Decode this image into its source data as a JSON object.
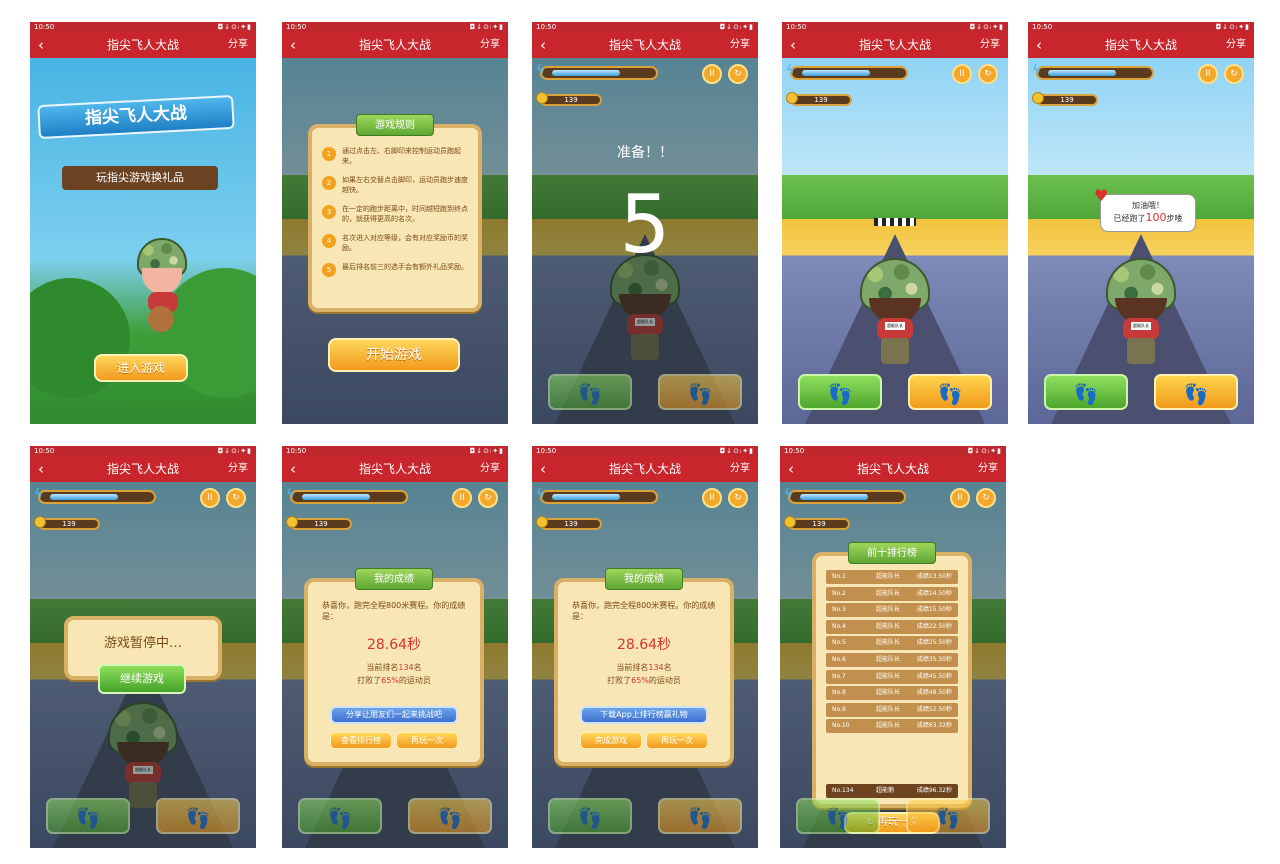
{
  "status": {
    "time": "10:50",
    "icons": "◘↓⊙ᵢ✦▮"
  },
  "app": {
    "title": "指尖飞人大战",
    "share": "分享",
    "back": "‹"
  },
  "welcome": {
    "logo": "指尖飞人大战",
    "subtitle": "玩指尖游戏换礼品",
    "enter_button": "进入游戏"
  },
  "rules": {
    "title": "游戏规则",
    "items": [
      {
        "n": "1",
        "text": "通过点击左、右脚印来控制运动员跑起来。"
      },
      {
        "n": "2",
        "text": "如果左右交替点击脚印，运动员跑步速度越快。"
      },
      {
        "n": "3",
        "text": "在一定的跑步距离中，时间越短跑到终点的，就获得更高的名次。"
      },
      {
        "n": "4",
        "text": "名次进入对应等级，会有对应奖励币的奖励。"
      },
      {
        "n": "5",
        "text": "最后排名前三的选手会有额外礼品奖励。"
      }
    ],
    "start_button": "开始游戏"
  },
  "hud": {
    "coins": "139",
    "pause_icon": "II",
    "restart_icon": "↻",
    "energy_ratio": 0.6
  },
  "countdown": {
    "ready": "准备！！",
    "number": "5"
  },
  "cheer": {
    "line1": "加油哦！",
    "line2_a": "已经跑了",
    "steps": "100",
    "line2_b": "步喽"
  },
  "pause": {
    "text": "游戏暂停中…",
    "continue_button": "继续游戏"
  },
  "result": {
    "title": "我的成绩",
    "intro": "恭喜你，跑完全程800米赛程。你的成绩是：",
    "time": "28.64秒",
    "rank_a": "当前排名",
    "rank_n": "134",
    "rank_b": "名",
    "beat_a": "打败了",
    "beat_n": "65%",
    "beat_b": "的运动员",
    "share_button": "分享让朋友们一起来挑战吧",
    "download_button": "下载App上排行榜赢礼物",
    "leaderboard_button": "查看排行榜",
    "replay_button": "再玩一次",
    "done_button": "完成游戏"
  },
  "leaderboard": {
    "title": "前十排行榜",
    "rows": [
      {
        "rank": "No.1",
        "name": "超能队长",
        "score": "成绩13.50秒"
      },
      {
        "rank": "No.2",
        "name": "超能队长",
        "score": "成绩14.50秒"
      },
      {
        "rank": "No.3",
        "name": "超能队长",
        "score": "成绩15.50秒"
      },
      {
        "rank": "No.4",
        "name": "超能队长",
        "score": "成绩22.50秒"
      },
      {
        "rank": "No.5",
        "name": "超能队长",
        "score": "成绩25.50秒"
      },
      {
        "rank": "No.6",
        "name": "超能队长",
        "score": "成绩35.50秒"
      },
      {
        "rank": "No.7",
        "name": "超能队长",
        "score": "成绩45.50秒"
      },
      {
        "rank": "No.8",
        "name": "超能队长",
        "score": "成绩48.50秒"
      },
      {
        "rank": "No.9",
        "name": "超能队长",
        "score": "成绩52.50秒"
      },
      {
        "rank": "No.10",
        "name": "超能队长",
        "score": "成绩63.32秒"
      }
    ],
    "me": {
      "rank": "No.134",
      "name": "超能鹅",
      "score": "成绩96.32秒"
    },
    "replay_button": "再玩一次"
  },
  "bib_text": "超能队长",
  "colors": {
    "header": "#c9252c",
    "accent_orange": "#f29a1c",
    "accent_green": "#5fa735",
    "panel": "#f8e6b4"
  }
}
